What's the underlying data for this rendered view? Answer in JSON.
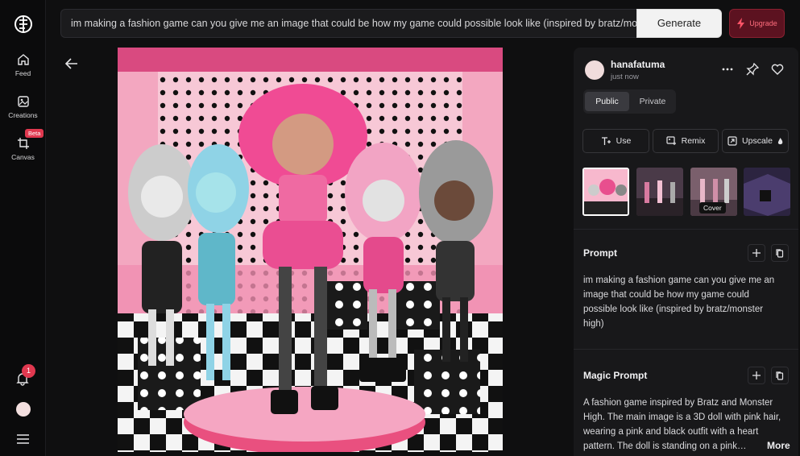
{
  "rail": {
    "items": [
      {
        "label": "Feed",
        "icon": "home-icon"
      },
      {
        "label": "Creations",
        "icon": "image-icon"
      },
      {
        "label": "Canvas",
        "icon": "crop-icon",
        "badge": "Beta"
      }
    ],
    "notifications_count": "1"
  },
  "topbar": {
    "prompt_value": "im making a fashion game can you give me an image that could be how my game could possible look like (inspired by bratz/monster high)",
    "generate_label": "Generate",
    "upgrade_label": "Upgrade"
  },
  "panel": {
    "username": "hanafatuma",
    "time": "just now",
    "visibility": {
      "public": "Public",
      "private": "Private"
    },
    "actions": {
      "use": "Use",
      "remix": "Remix",
      "upscale": "Upscale"
    },
    "cover_tooltip": "Cover",
    "prompt_section": {
      "title": "Prompt",
      "text": "im making a fashion game can you give me an image that could be how my game could possible look like (inspired by bratz/monster high)"
    },
    "magic_prompt_section": {
      "title": "Magic Prompt",
      "text": "A fashion game inspired by Bratz and Monster High. The main image is a 3D doll with pink hair, wearing a pink and black outfit with a heart pattern. The doll is standing on a pink…",
      "more_label": "More"
    }
  },
  "colors": {
    "accent": "#e0384f",
    "upgrade_bg": "#5c1220",
    "panel_bg": "#18181a"
  }
}
